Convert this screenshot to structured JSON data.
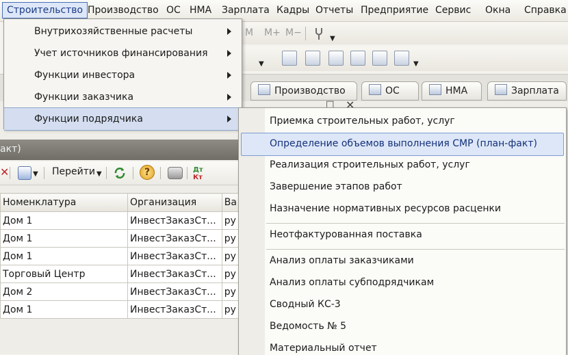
{
  "menubar": {
    "items": [
      "Строительство",
      "Производство",
      "ОС",
      "НМА",
      "Зарплата",
      "Кадры",
      "Отчеты",
      "Предприятие",
      "Сервис",
      "Окна",
      "Справка"
    ]
  },
  "toolbar": {
    "memory_buttons": [
      "M",
      "M+",
      "M−"
    ]
  },
  "tabs": [
    "Производство",
    "ОС",
    "НМА",
    "Зарплата"
  ],
  "window": {
    "title_fragment": "акт)",
    "goto_label": "Перейти",
    "columns": [
      "Номенклатура",
      "Организация",
      "Ва"
    ],
    "rows": [
      [
        "Дом 1",
        "ИнвестЗаказСт...",
        "ру"
      ],
      [
        "Дом 1",
        "ИнвестЗаказСт...",
        "ру"
      ],
      [
        "Дом 1",
        "ИнвестЗаказСт...",
        "ру"
      ],
      [
        "Торговый Центр",
        "ИнвестЗаказСт...",
        "ру"
      ],
      [
        "Дом 2",
        "ИнвестЗаказСт...",
        "ру"
      ],
      [
        "Дом 1",
        "ИнвестЗаказСт...",
        "ру"
      ]
    ]
  },
  "dropdown": {
    "items": [
      "Внутрихозяйственные расчеты",
      "Учет источников финансирования",
      "Функции инвестора",
      "Функции заказчика",
      "Функции подрядчика"
    ],
    "highlighted_index": 4
  },
  "submenu": {
    "items": [
      "Приемка строительных работ, услуг",
      "Определение объемов выполнения СМР (план-факт)",
      "Реализация строительных работ, услуг",
      "Завершение этапов работ",
      "Назначение нормативных ресурсов расценки",
      "Неотфактурованная поставка",
      "Анализ оплаты заказчиками",
      "Анализ оплаты субподрядчикам",
      "Сводный КС-3",
      "Ведомость № 5",
      "Материальный отчет"
    ],
    "highlighted_index": 1
  },
  "colors": {
    "menu_highlight": "#dde7f7",
    "menu_highlight_border": "#7f9ad0",
    "window_header": "#7f7d76"
  }
}
